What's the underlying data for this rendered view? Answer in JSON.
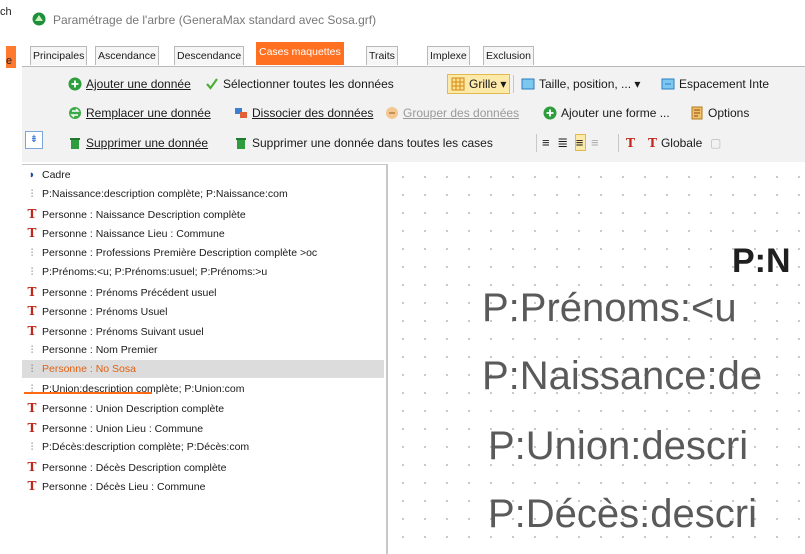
{
  "background_window": {
    "fragment_top": "ch",
    "fragment_tab": "e"
  },
  "window": {
    "title": "Paramétrage de l'arbre (GeneraMax standard avec Sosa.grf)"
  },
  "tabs": [
    "Principales",
    "Ascendance",
    "Descendance",
    "Cases maquettes",
    "Traits",
    "Implexe",
    "Exclusion"
  ],
  "active_tab": "Cases maquettes",
  "toolbar": {
    "row1": {
      "add_data": "Ajouter une donnée",
      "select_all": "Sélectionner toutes les données",
      "grid": "Grille",
      "size_pos": "Taille, position, ...",
      "spacing": "Espacement Inte"
    },
    "row2": {
      "replace": "Remplacer une donnée",
      "dissociate": "Dissocier des données",
      "group": "Grouper des données",
      "add_shape": "Ajouter une forme ...",
      "options": "Options"
    },
    "row3": {
      "delete": "Supprimer une donnée",
      "delete_all": "Supprimer une donnée dans toutes les cases",
      "global": "Globale"
    }
  },
  "tree": {
    "items": [
      {
        "icon": "frame-icon",
        "label": "Cadre"
      },
      {
        "icon": "compound-icon",
        "label": "P:Naissance:description complète; P:Naissance:com"
      },
      {
        "icon": "text-icon",
        "label": "Personne : Naissance Description complète"
      },
      {
        "icon": "text-icon",
        "label": "Personne : Naissance Lieu : Commune"
      },
      {
        "icon": "compound-icon",
        "label": "Personne : Professions Première Description complète >oc"
      },
      {
        "icon": "compound-icon",
        "label": "P:Prénoms:<u; P:Prénoms:usuel; P:Prénoms:>u"
      },
      {
        "icon": "text-icon",
        "label": "Personne : Prénoms Précédent usuel"
      },
      {
        "icon": "text-icon",
        "label": "Personne : Prénoms Usuel"
      },
      {
        "icon": "text-icon",
        "label": "Personne : Prénoms Suivant usuel"
      },
      {
        "icon": "compound-icon",
        "label": "Personne : Nom Premier"
      },
      {
        "icon": "compound-icon",
        "label": "Personne : No Sosa"
      },
      {
        "icon": "compound-icon",
        "label": "P:Union:description complète; P:Union:com"
      },
      {
        "icon": "text-icon",
        "label": "Personne : Union Description complète"
      },
      {
        "icon": "text-icon",
        "label": "Personne : Union Lieu : Commune"
      },
      {
        "icon": "compound-icon",
        "label": "P:Décès:description complète; P:Décès:com"
      },
      {
        "icon": "text-icon",
        "label": "Personne : Décès Description complète"
      },
      {
        "icon": "text-icon",
        "label": "Personne : Décès Lieu : Commune"
      }
    ],
    "selected_index": 10
  },
  "preview": {
    "heading": "P:N",
    "line1": "P:Prénoms:<u",
    "line2": "P:Naissance:de",
    "line3": "P:Union:descri",
    "line4": "P:Décès:descri"
  },
  "colors": {
    "accent": "#ff7121",
    "highlight": "#ff6a14",
    "text_icon": "#c0281c"
  }
}
